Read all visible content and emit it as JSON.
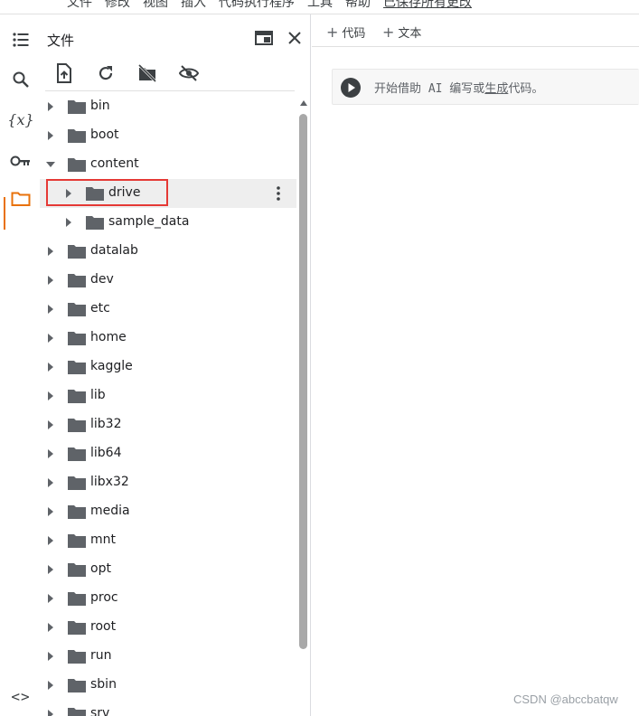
{
  "menu": {
    "items": [
      "文件",
      "修改",
      "视图",
      "插入",
      "代码执行程序",
      "工具",
      "帮助"
    ],
    "saved_status": "已保存所有更改"
  },
  "rail": {
    "icons": [
      "toc-icon",
      "search-icon",
      "variables-icon",
      "key-icon",
      "folder-icon",
      "code-icon"
    ],
    "variables_glyph": "{x}",
    "code_glyph": "<>"
  },
  "files_panel": {
    "title": "文件",
    "tree": [
      {
        "label": "bin",
        "expanded": false,
        "depth": 0
      },
      {
        "label": "boot",
        "expanded": false,
        "depth": 0
      },
      {
        "label": "content",
        "expanded": true,
        "depth": 0
      },
      {
        "label": "drive",
        "expanded": false,
        "depth": 1,
        "selected": true
      },
      {
        "label": "sample_data",
        "expanded": false,
        "depth": 1
      },
      {
        "label": "datalab",
        "expanded": false,
        "depth": 0
      },
      {
        "label": "dev",
        "expanded": false,
        "depth": 0
      },
      {
        "label": "etc",
        "expanded": false,
        "depth": 0
      },
      {
        "label": "home",
        "expanded": false,
        "depth": 0
      },
      {
        "label": "kaggle",
        "expanded": false,
        "depth": 0
      },
      {
        "label": "lib",
        "expanded": false,
        "depth": 0
      },
      {
        "label": "lib32",
        "expanded": false,
        "depth": 0
      },
      {
        "label": "lib64",
        "expanded": false,
        "depth": 0
      },
      {
        "label": "libx32",
        "expanded": false,
        "depth": 0
      },
      {
        "label": "media",
        "expanded": false,
        "depth": 0
      },
      {
        "label": "mnt",
        "expanded": false,
        "depth": 0
      },
      {
        "label": "opt",
        "expanded": false,
        "depth": 0
      },
      {
        "label": "proc",
        "expanded": false,
        "depth": 0
      },
      {
        "label": "root",
        "expanded": false,
        "depth": 0
      },
      {
        "label": "run",
        "expanded": false,
        "depth": 0
      },
      {
        "label": "sbin",
        "expanded": false,
        "depth": 0
      },
      {
        "label": "srv",
        "expanded": false,
        "depth": 0
      }
    ]
  },
  "main": {
    "add_code": "代码",
    "add_text": "文本",
    "cell_placeholder_prefix": "开始借助 AI 编写或",
    "cell_placeholder_link": "生成",
    "cell_placeholder_suffix": "代码。"
  },
  "watermark": "CSDN @abccbatqw",
  "colors": {
    "accent_orange": "#e8710a",
    "highlight_red": "#e53935",
    "folder_gray": "#5f6368"
  }
}
